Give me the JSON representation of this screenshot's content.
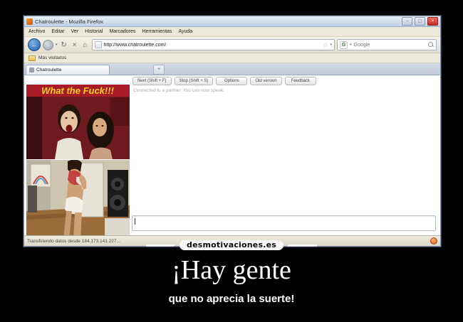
{
  "poster": {
    "watermark": "desmotivaciones.es",
    "title": "¡Hay gente",
    "subtitle": "que no aprecia la suerte!"
  },
  "browser": {
    "window_title": "Chatroulette - Mozilla Firefox",
    "window_controls": {
      "minimize": "–",
      "maximize": "▢",
      "close": "×"
    },
    "menu": [
      "Archivo",
      "Editar",
      "Ver",
      "Historial",
      "Marcadores",
      "Herramientas",
      "Ayuda"
    ],
    "icons": {
      "back": "←",
      "forward": "→",
      "dropdown": "▾",
      "reload": "↻",
      "stop": "×",
      "home": "⌂",
      "star": "☆",
      "google_g": "G",
      "new_tab": "+"
    },
    "url": "http://www.chatroulette.com/",
    "search_value": "Google",
    "bookmarks_bar_label": "Más visitados",
    "tab_label": "Chatroulette",
    "status_text": "Transfiriendo datos desde 184.173.141.227...",
    "accent_colors": {
      "close_red": "#c42f23",
      "back_blue": "#1f5fb0",
      "toolbar_tan": "#ece9da"
    }
  },
  "chat": {
    "buttons": [
      "Next (Shift + F)",
      "Stop (Shift + S)",
      "Options",
      "Old version",
      "Feedback"
    ],
    "status": "Connected to a partner. You can now speak.",
    "input_value": ""
  },
  "videos": {
    "top_overlay": "What the Fuck!!!"
  }
}
